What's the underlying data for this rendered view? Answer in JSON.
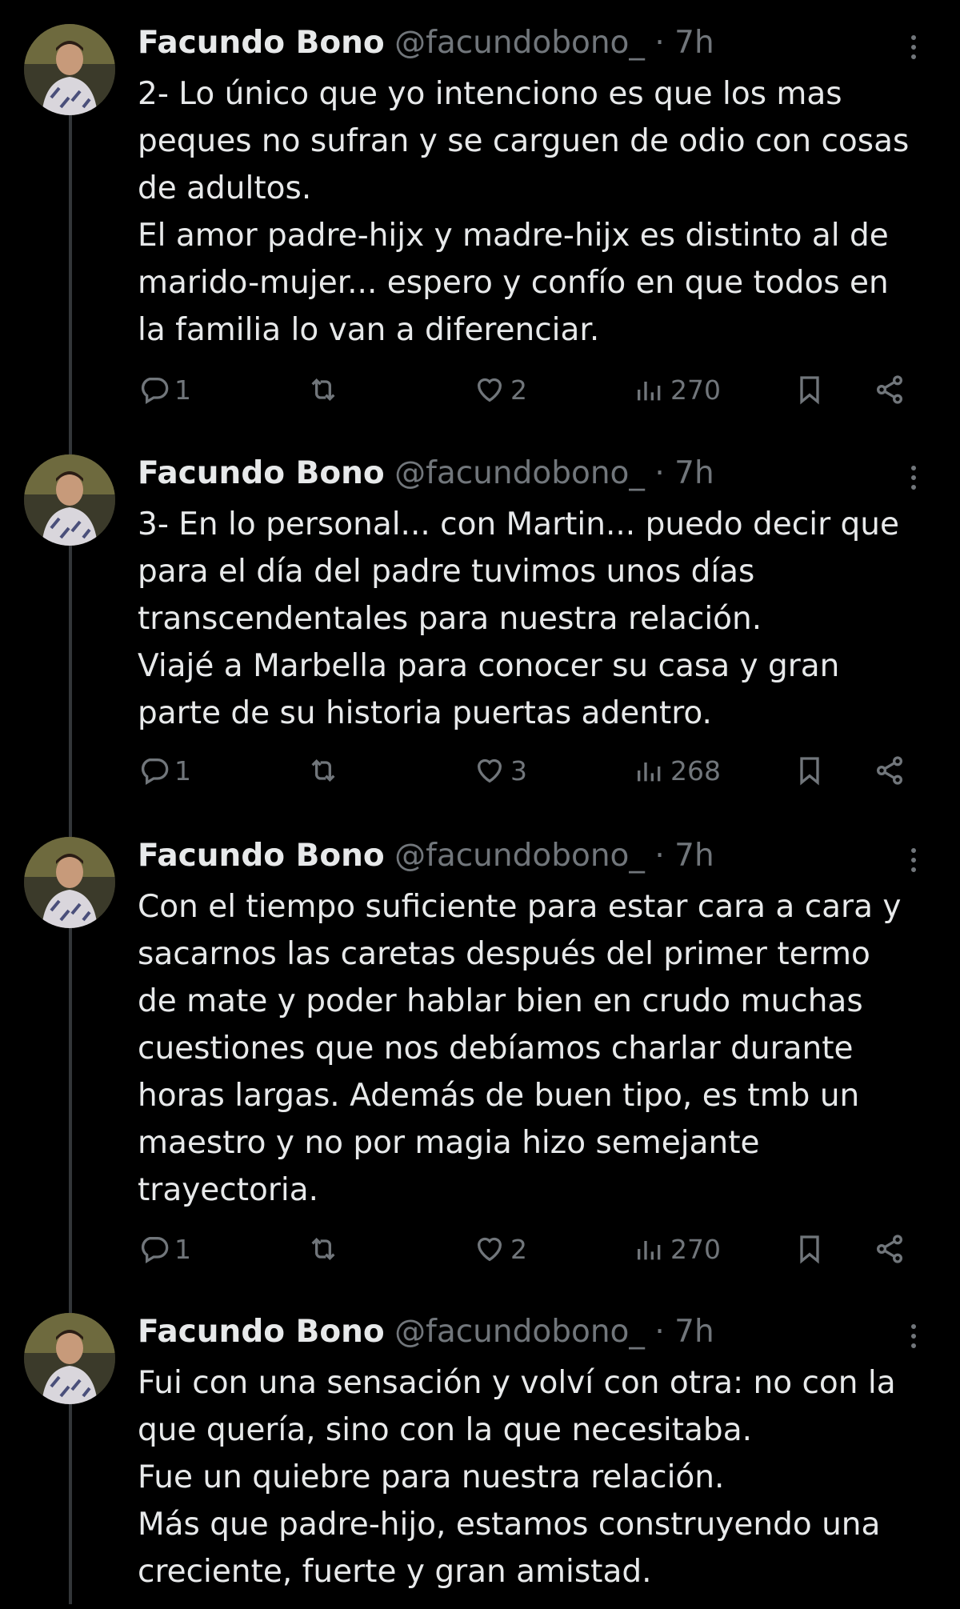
{
  "tweets": [
    {
      "name": "Facundo Bono",
      "handle": "@facundobono_",
      "time": "7h",
      "text": "2- Lo único que yo intenciono es que los mas\npeques no sufran y se carguen de odio con cosas\nde adultos.\nEl amor padre-hijx y madre-hijx es distinto al de\nmarido-mujer... espero y confío en que todos en\nla familia lo van a diferenciar.",
      "replies": "1",
      "likes": "2",
      "views": "270",
      "icons": [
        "reply-icon",
        "retweet-icon",
        "like-icon",
        "views-icon",
        "bookmark-icon",
        "share-icon"
      ]
    },
    {
      "name": "Facundo Bono",
      "handle": "@facundobono_",
      "time": "7h",
      "text": "3- En lo personal... con Martin... puedo decir que\npara el día del padre tuvimos unos días\ntranscendentales para nuestra relación.\nViajé a Marbella para conocer su casa y gran\nparte de su historia puertas adentro.",
      "replies": "1",
      "likes": "3",
      "views": "268",
      "icons": [
        "reply-icon",
        "retweet-icon",
        "like-icon",
        "views-icon",
        "bookmark-icon",
        "share-icon"
      ]
    },
    {
      "name": "Facundo Bono",
      "handle": "@facundobono_",
      "time": "7h",
      "text": "Con el tiempo suficiente para estar cara a cara y\nsacarnos las caretas después del primer termo\nde mate y poder hablar bien en crudo muchas\ncuestiones que nos debíamos charlar durante\nhoras largas. Además de buen tipo, es tmb un\nmaestro y no por magia hizo semejante\ntrayectoria.",
      "replies": "1",
      "likes": "2",
      "views": "270",
      "icons": [
        "reply-icon",
        "retweet-icon",
        "like-icon",
        "views-icon",
        "bookmark-icon",
        "share-icon"
      ]
    },
    {
      "name": "Facundo Bono",
      "handle": "@facundobono_",
      "time": "7h",
      "text": "Fui con una sensación y volví con otra: no con la\nque quería, sino con la que necesitaba.\nFue un quiebre para nuestra relación.\nMás que padre-hijo, estamos construyendo una\ncreciente, fuerte y gran amistad."
    }
  ],
  "colors": {
    "background": "#000000",
    "text": "#e7e9ea",
    "muted": "#71767b",
    "thread_line": "#333639"
  }
}
